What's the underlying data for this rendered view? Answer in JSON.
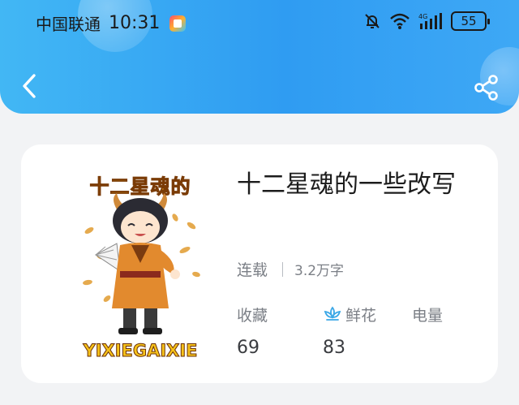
{
  "status_bar": {
    "carrier": "中国联通",
    "time": "10:31",
    "network": "4G",
    "battery": "55"
  },
  "book": {
    "title": "十二星魂的一些改写",
    "status": "连载",
    "word_count": "3.2万字",
    "cover": {
      "title": "十二星魂的",
      "subtitle": "YIXIEGAIXIE"
    },
    "stats": [
      {
        "label": "收藏",
        "value": "69",
        "icon": null
      },
      {
        "label": "鲜花",
        "value": "83",
        "icon": "lotus-icon"
      },
      {
        "label": "电量",
        "value": null,
        "icon": null
      }
    ]
  },
  "colors": {
    "header_start": "#42b7f4",
    "header_end": "#2f9cf2",
    "background": "#f2f3f5",
    "card": "#ffffff",
    "muted_text": "#7b7f86",
    "cover_title": "#f6b11a"
  }
}
